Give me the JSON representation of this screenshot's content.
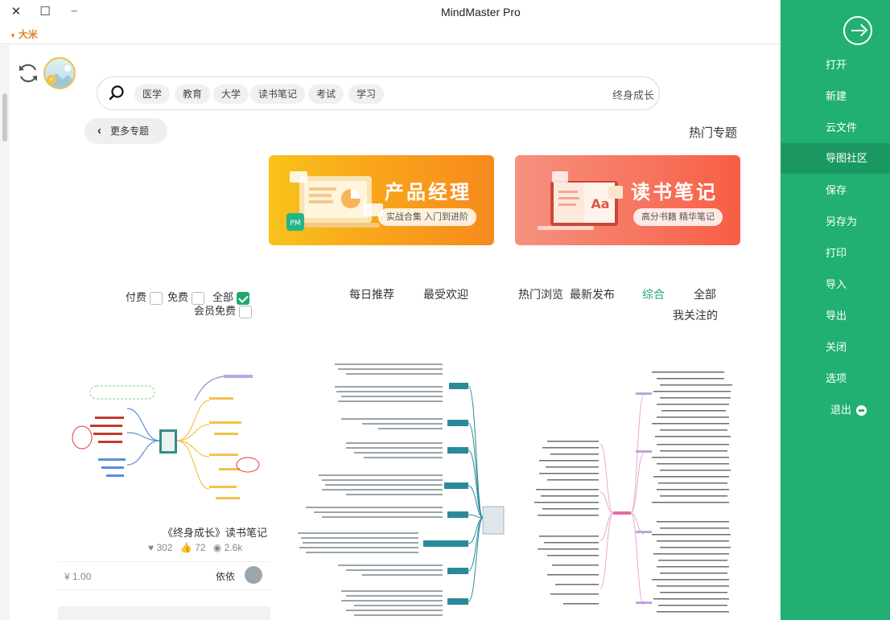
{
  "window": {
    "title": "MindMaster Pro",
    "close_glyph": "✕",
    "maximize_glyph": "☐",
    "minimize_glyph": "─"
  },
  "language": {
    "label": "大米"
  },
  "search": {
    "tags": [
      "医学",
      "教育",
      "大学",
      "读书笔记",
      "考试",
      "学习"
    ],
    "value": "终身成长"
  },
  "hot": {
    "more_label": "更多专题",
    "section_title": "热门专题",
    "banners": [
      {
        "title": "产品经理",
        "subtitle": "实战合集 入门到进阶",
        "badge": "PM",
        "color": "#f9a31b"
      },
      {
        "title": "读书笔记",
        "subtitle": "高分书籍 精华笔记",
        "badge": "Aa",
        "color": "#f7735d"
      }
    ]
  },
  "filters": {
    "categories": [
      "全部",
      "综合",
      "最新发布",
      "热门浏览",
      "最受欢迎",
      "每日推荐"
    ],
    "active_category": "综合",
    "second_line": "我关注的",
    "price_options": [
      {
        "label": "全部",
        "checked": true
      },
      {
        "label": "免费",
        "checked": false
      },
      {
        "label": "付费",
        "checked": false
      }
    ],
    "member_free": {
      "label": "会员免费",
      "checked": false
    }
  },
  "cards": [
    {
      "title": "《终身成长》读书笔记",
      "views": "2.6k",
      "likes": "72",
      "favorites": "302",
      "author": "依依",
      "price": "¥ 1.00"
    }
  ],
  "menu": {
    "items": [
      "打开",
      "新建",
      "云文件",
      "导图社区",
      "保存",
      "另存为",
      "打印",
      "导入",
      "导出",
      "关闭",
      "选项",
      "退出"
    ],
    "active": "导图社区",
    "accent": "#21b072"
  },
  "icons": [
    "close-icon",
    "maximize-icon",
    "minimize-icon",
    "refresh-icon",
    "search-icon",
    "back-arrow-icon",
    "eye-icon",
    "thumb-up-icon",
    "heart-icon",
    "exit-icon"
  ]
}
